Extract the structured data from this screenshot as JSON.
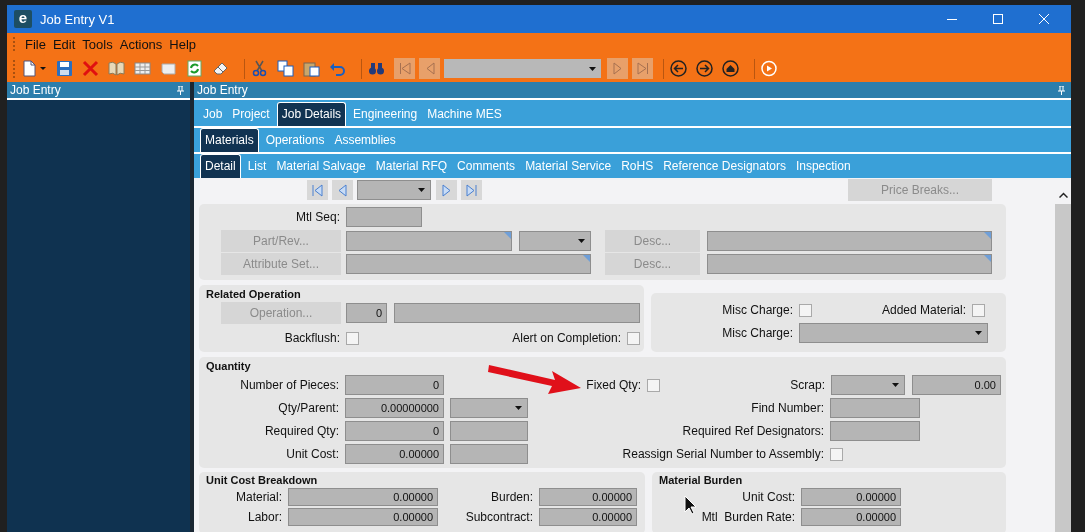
{
  "window": {
    "logo": "e",
    "title": "Job Entry V1"
  },
  "menu": [
    "File",
    "Edit",
    "Tools",
    "Actions",
    "Help"
  ],
  "left_panel": {
    "title": "Job Entry"
  },
  "main_panel": {
    "title": "Job Entry"
  },
  "tabs": [
    {
      "label": "Job",
      "selected": false
    },
    {
      "label": "Project",
      "selected": false
    },
    {
      "label": "Job Details",
      "selected": true
    },
    {
      "label": "Engineering",
      "selected": false
    },
    {
      "label": "Machine MES",
      "selected": false
    }
  ],
  "subtabs": [
    {
      "label": "Materials",
      "selected": true
    },
    {
      "label": "Operations",
      "selected": false
    },
    {
      "label": "Assemblies",
      "selected": false
    }
  ],
  "detail_tabs": [
    {
      "label": "Detail",
      "selected": true
    },
    {
      "label": "List",
      "selected": false
    },
    {
      "label": "Material Salvage",
      "selected": false
    },
    {
      "label": "Material RFQ",
      "selected": false
    },
    {
      "label": "Comments",
      "selected": false
    },
    {
      "label": "Material Service",
      "selected": false
    },
    {
      "label": "RoHS",
      "selected": false
    },
    {
      "label": "Reference Designators",
      "selected": false
    },
    {
      "label": "Inspection",
      "selected": false
    }
  ],
  "price_breaks_button": {
    "label": "Price Breaks...",
    "disabled": true
  },
  "material": {
    "mtl_seq_label": "Mtl Seq:",
    "part_rev_button": {
      "label": "Part/Rev...",
      "disabled": true
    },
    "desc_button_1": {
      "label": "Desc...",
      "disabled": true
    },
    "attribute_set_button": {
      "label": "Attribute Set...",
      "disabled": true
    },
    "desc_button_2": {
      "label": "Desc...",
      "disabled": true
    }
  },
  "related_operation": {
    "title": "Related Operation",
    "operation_button": {
      "label": "Operation...",
      "disabled": true
    },
    "operation_seq": "0",
    "backflush": {
      "label": "Backflush:",
      "checked": false
    },
    "alert_on_completion": {
      "label": "Alert on Completion:",
      "checked": false
    }
  },
  "misc": {
    "misc_charge_flag": {
      "label": "Misc Charge:",
      "checked": false
    },
    "added_material": {
      "label": "Added Material:",
      "checked": false
    },
    "misc_charge_label": "Misc Charge:"
  },
  "quantity": {
    "title": "Quantity",
    "number_of_pieces": {
      "label": "Number of Pieces:",
      "value": "0"
    },
    "qty_parent": {
      "label": "Qty/Parent:",
      "value": "0.00000000"
    },
    "required_qty": {
      "label": "Required Qty:",
      "value": "0"
    },
    "unit_cost": {
      "label": "Unit Cost:",
      "value": "0.00000"
    },
    "fixed_qty": {
      "label": "Fixed Qty:",
      "checked": false
    },
    "scrap": {
      "label": "Scrap:",
      "value": "0.00"
    },
    "find_number_label": "Find Number:",
    "required_ref_designators_label": "Required Ref Designators:",
    "reassign_serial": {
      "label": "Reassign Serial Number to Assembly:",
      "checked": false
    }
  },
  "unit_cost_breakdown": {
    "title": "Unit Cost Breakdown",
    "material": {
      "label": "Material:",
      "value": "0.00000"
    },
    "burden": {
      "label": "Burden:",
      "value": "0.00000"
    },
    "labor": {
      "label": "Labor:",
      "value": "0.00000"
    },
    "subcontract": {
      "label": "Subcontract:",
      "value": "0.00000"
    }
  },
  "material_burden": {
    "title": "Material Burden",
    "unit_cost": {
      "label": "Unit Cost:",
      "value": "0.00000"
    },
    "burden_rate": {
      "label": "Mtl  Burden Rate:",
      "value": "0.00000"
    }
  }
}
